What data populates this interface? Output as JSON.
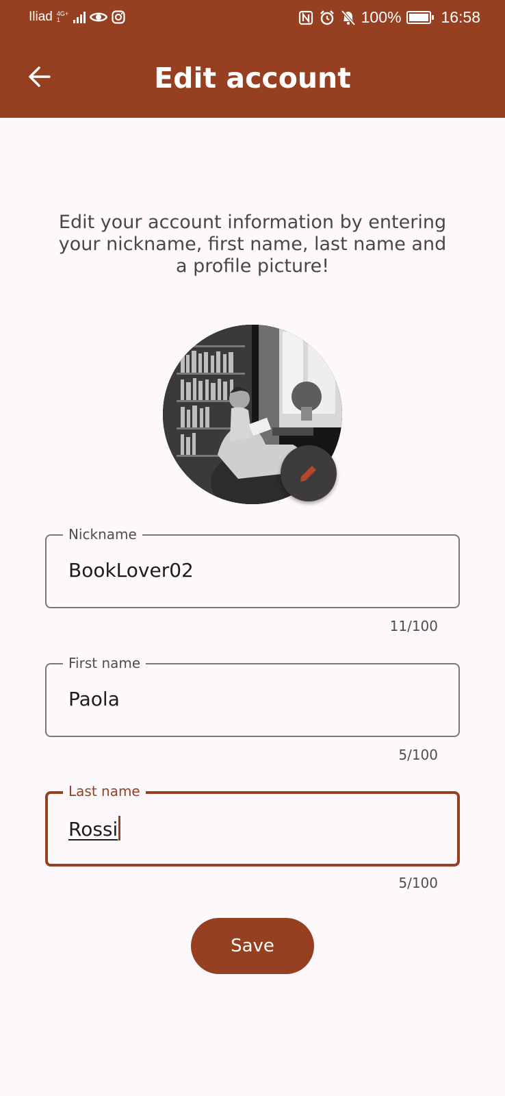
{
  "status_bar": {
    "carrier": "Iliad",
    "network_top": "4G+",
    "network_bottom": "1",
    "battery": "100%",
    "time": "16:58"
  },
  "header": {
    "title": "Edit account",
    "back_icon": "arrow-back-icon"
  },
  "intro_text": "Edit your account information by entering your nickname, first name, last name and a profile picture!",
  "avatar": {
    "description_icon": "profile-picture",
    "edit_icon": "pencil-icon"
  },
  "fields": {
    "nickname": {
      "label": "Nickname",
      "value": "BookLover02",
      "counter": "11/100"
    },
    "first_name": {
      "label": "First name",
      "value": "Paola",
      "counter": "5/100"
    },
    "last_name": {
      "label": "Last name",
      "value": "Rossi",
      "counter": "5/100"
    }
  },
  "save_label": "Save",
  "colors": {
    "primary": "#963f21",
    "background": "#fdf8fb",
    "fab": "#3d3b3c",
    "outline": "#807679"
  }
}
